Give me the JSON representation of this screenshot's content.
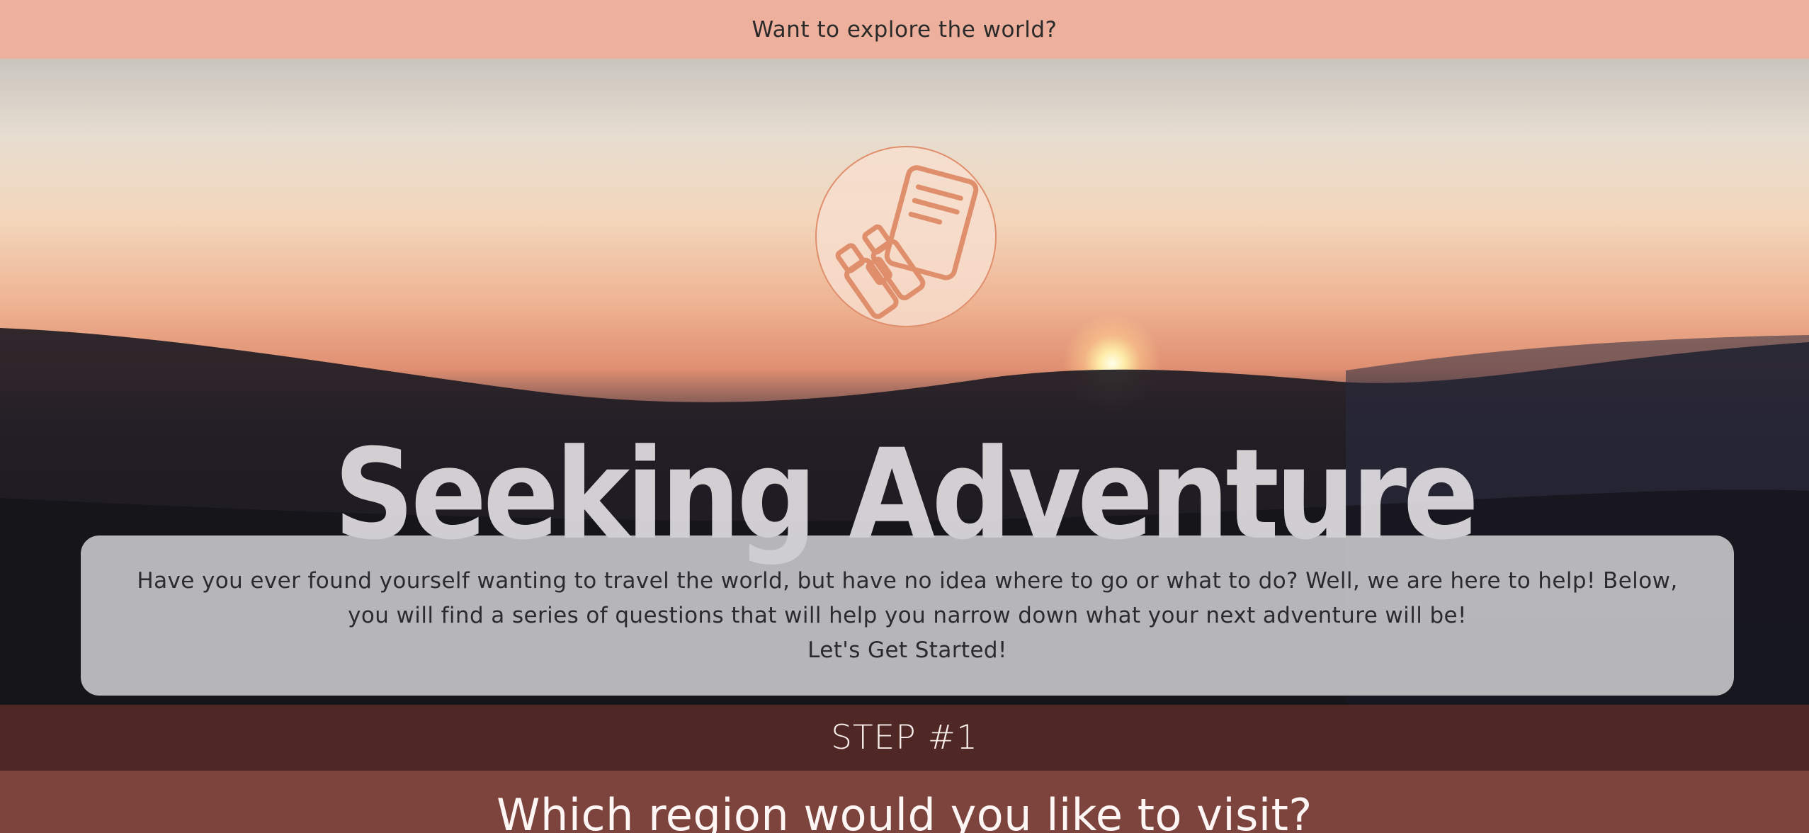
{
  "top_banner": {
    "text": "Want to explore the world?"
  },
  "hero": {
    "emblem_icon": "binoculars-and-map-icon",
    "title": "Seeking Adventure",
    "intro": {
      "paragraph": "Have you ever found yourself wanting to travel the world, but have no idea where to go or what to do? Well, we are here to help! Below, you will find a series of questions that will help you narrow down what your next adventure will be!",
      "cta_text": "Let's Get Started!"
    }
  },
  "step": {
    "label": "STEP #1"
  },
  "question": {
    "text": "Which region would you like to visit?"
  },
  "colors": {
    "banner": "#ecb09c",
    "accent_icon": "#e08f6d",
    "step_bar": "#4f2825",
    "question_bar": "#7c443d"
  }
}
